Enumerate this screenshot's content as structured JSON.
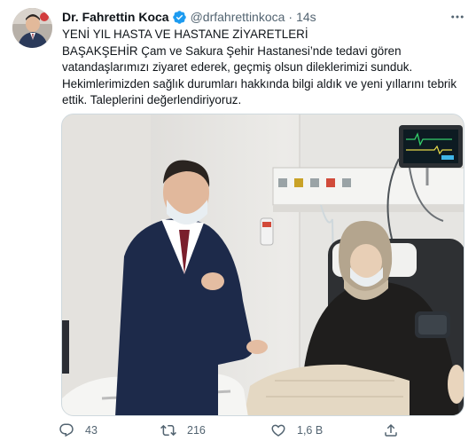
{
  "tweet": {
    "author_name": "Dr. Fahrettin Koca",
    "handle": "@drfahrettinkoca",
    "separator": "·",
    "time": "14s",
    "text_lines": [
      "YENİ YIL HASTA VE HASTANE ZİYARETLERİ",
      "BAŞAKŞEHİR Çam ve Sakura Şehir Hastanesi’nde tedavi gören",
      "vatandaşlarımızı ziyaret ederek, geçmiş olsun dileklerimizi sunduk.",
      "Hekimlerimizden sağlık durumları hakkında bilgi aldık ve yeni yıllarını tebrik",
      "ettik. Taleplerini değerlendiriyoruz."
    ],
    "verified_color": "#1d9bf0",
    "icons": {
      "more": "more-icon",
      "reply": "reply-icon",
      "retweet": "retweet-icon",
      "like": "like-icon",
      "share": "share-icon",
      "verified": "verified-badge-icon"
    }
  },
  "actions": {
    "reply_count": "43",
    "retweet_count": "216",
    "like_count": "1,6 B"
  }
}
